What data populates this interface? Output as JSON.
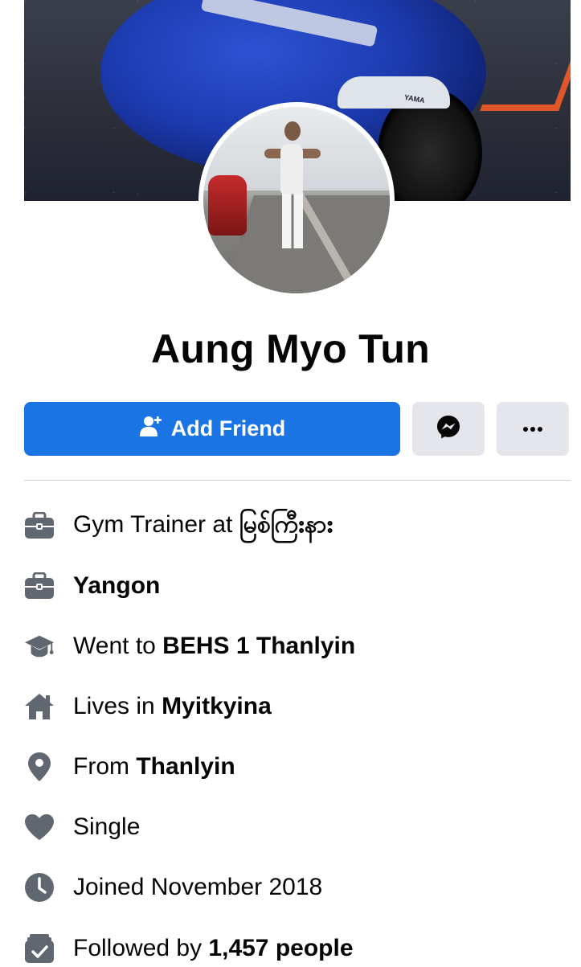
{
  "profile": {
    "name": "Aung Myo Tun",
    "cover_tag": "YAMA"
  },
  "actions": {
    "add_friend_label": "Add Friend",
    "messenger_icon": "messenger-icon",
    "more_label": "···"
  },
  "colors": {
    "primary": "#1b74e4",
    "button_grey": "#e4e6eb",
    "icon_grey": "#606770",
    "text": "#050505"
  },
  "info": [
    {
      "icon": "briefcase-icon",
      "prefix": "Gym Trainer at ",
      "bold": "",
      "suffix": "မြစ်ကြီးနား"
    },
    {
      "icon": "briefcase-icon",
      "prefix": "",
      "bold": "Yangon",
      "suffix": ""
    },
    {
      "icon": "graduation-cap-icon",
      "prefix": "Went to ",
      "bold": "BEHS 1 Thanlyin",
      "suffix": ""
    },
    {
      "icon": "home-icon",
      "prefix": "Lives in ",
      "bold": "Myitkyina",
      "suffix": ""
    },
    {
      "icon": "location-pin-icon",
      "prefix": "From ",
      "bold": "Thanlyin",
      "suffix": ""
    },
    {
      "icon": "heart-icon",
      "prefix": "Single",
      "bold": "",
      "suffix": ""
    },
    {
      "icon": "clock-icon",
      "prefix": "Joined November 2018",
      "bold": "",
      "suffix": ""
    },
    {
      "icon": "followers-icon",
      "prefix": "Followed by ",
      "bold": "1,457 people",
      "suffix": ""
    }
  ]
}
